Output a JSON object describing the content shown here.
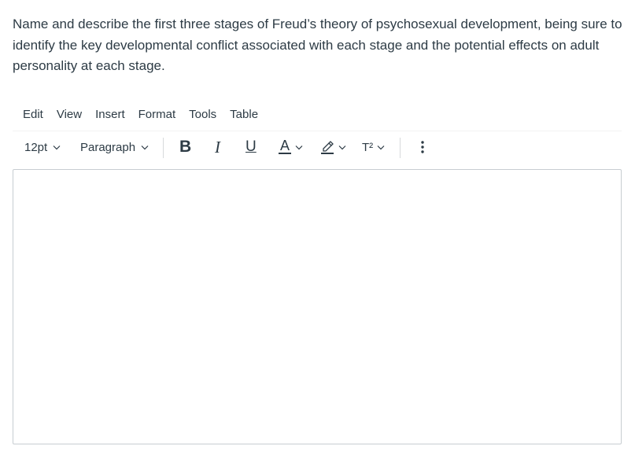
{
  "question": {
    "text": "Name and describe the first three stages of Freud’s theory of psychosexual development, being sure to identify the key developmental conflict associated with each stage and the potential effects on adult personality at each stage."
  },
  "menubar": {
    "items": [
      {
        "label": "Edit"
      },
      {
        "label": "View"
      },
      {
        "label": "Insert"
      },
      {
        "label": "Format"
      },
      {
        "label": "Tools"
      },
      {
        "label": "Table"
      }
    ]
  },
  "toolbar": {
    "font_size": "12pt",
    "block_format": "Paragraph",
    "bold_label": "B",
    "italic_label": "I",
    "underline_label": "U",
    "text_color_label": "A",
    "superscript_label": "T²",
    "icons": {
      "highlight": "highlighter-icon",
      "more": "more-vertical-icon",
      "chevron": "chevron-down-icon"
    },
    "text_color_underline": "#2d3b45"
  },
  "editor": {
    "content": ""
  },
  "colors": {
    "text": "#2d3b45",
    "border": "#c7cdd1",
    "separator": "#d7dadc"
  }
}
